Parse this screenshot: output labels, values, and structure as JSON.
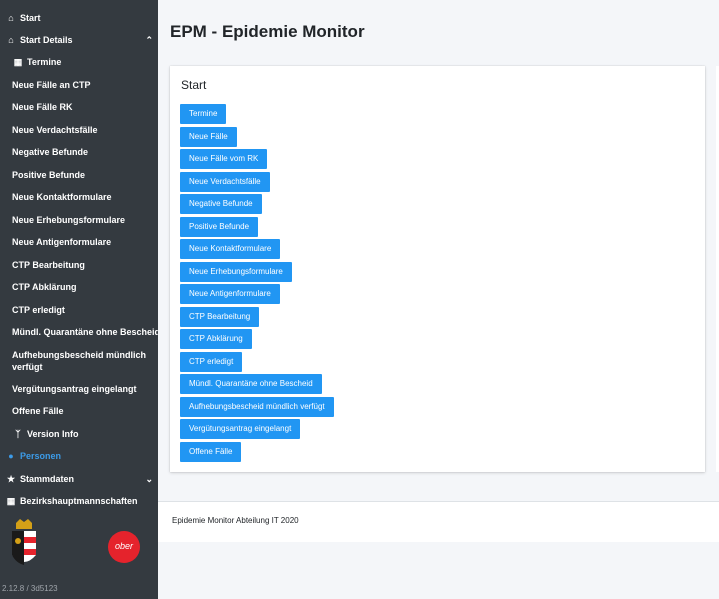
{
  "sidebar": {
    "items": [
      {
        "label": "Start",
        "icon": "home-icon"
      },
      {
        "label": "Start Details",
        "icon": "home-icon"
      },
      {
        "label": "Termine",
        "icon": "calendar-icon"
      },
      {
        "label": "Neue Fälle an CTP"
      },
      {
        "label": "Neue Fälle RK"
      },
      {
        "label": "Neue Verdachtsfälle"
      },
      {
        "label": "Negative Befunde"
      },
      {
        "label": "Positive Befunde"
      },
      {
        "label": "Neue Kontaktformulare"
      },
      {
        "label": "Neue Erhebungsformulare"
      },
      {
        "label": "Neue Antigenformulare"
      },
      {
        "label": "CTP Bearbeitung"
      },
      {
        "label": "CTP Abklärung"
      },
      {
        "label": "CTP erledigt"
      },
      {
        "label": "Mündl. Quarantäne ohne Bescheid"
      },
      {
        "label": "Aufhebungsbescheid mündlich verfügt"
      },
      {
        "label": "Vergütungsantrag eingelangt"
      },
      {
        "label": "Offene Fälle"
      },
      {
        "label": "Version Info",
        "icon": "branch-icon"
      },
      {
        "label": "Personen",
        "icon": "users-icon"
      },
      {
        "label": "Stammdaten",
        "icon": "star-icon"
      },
      {
        "label": "Bezirkshauptmannschaften",
        "icon": "building-icon"
      }
    ],
    "logo_right_text": "ober",
    "version": "2.12.8 / 3d5123"
  },
  "colors": {
    "sidebar_bg": "#343a40",
    "accent": "#2196f3",
    "active": "#3c9be8"
  },
  "main": {
    "title": "EPM - Epidemie Monitor",
    "card_title": "Start",
    "buttons": [
      "Termine",
      "Neue Fälle",
      "Neue Fälle vom RK",
      "Neue Verdachtsfälle",
      "Negative Befunde",
      "Positive Befunde",
      "Neue Kontaktformulare",
      "Neue Erhebungsformulare",
      "Neue Antigenformulare",
      "CTP Bearbeitung",
      "CTP Abklärung",
      "CTP erledigt",
      "Mündl. Quarantäne ohne Bescheid",
      "Aufhebungsbescheid mündlich verfügt",
      "Vergütungsantrag eingelangt",
      "Offene Fälle"
    ]
  },
  "footer": {
    "text": "Epidemie Monitor Abteilung IT 2020"
  }
}
